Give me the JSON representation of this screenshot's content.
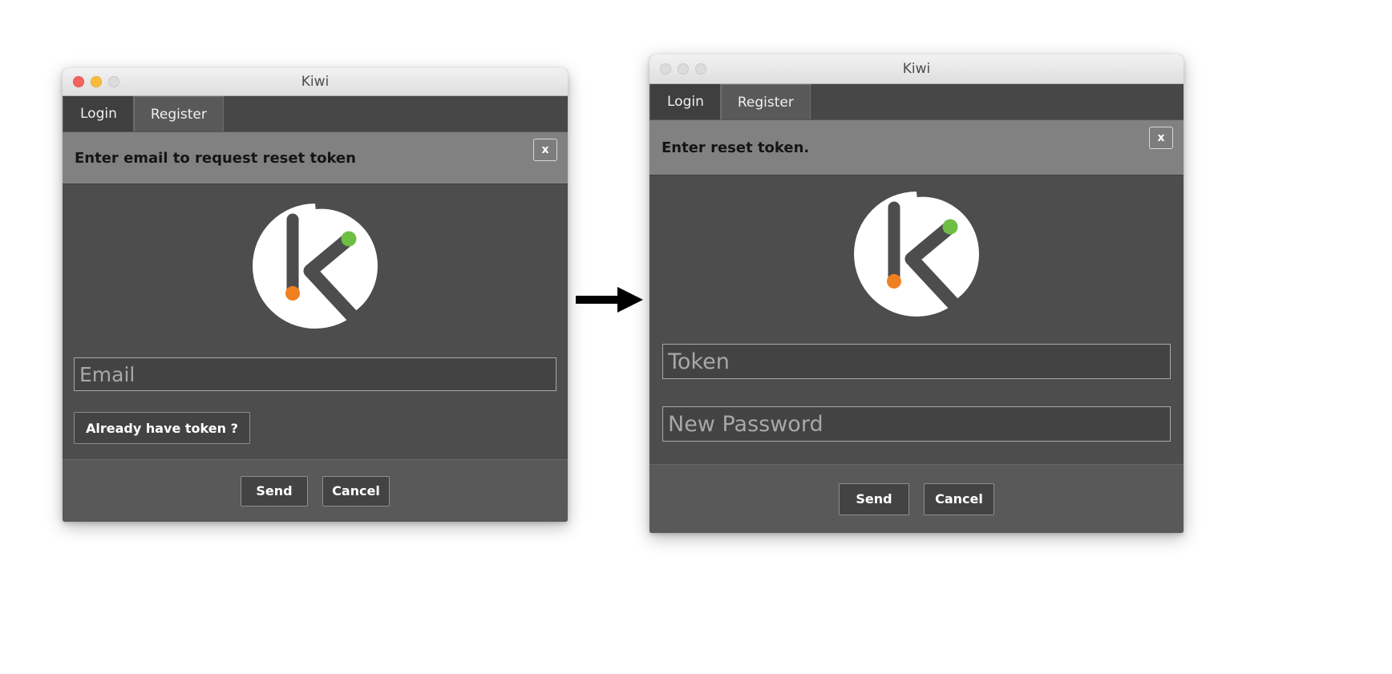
{
  "background_color": "#ffffff",
  "arrow": {
    "name": "flow-arrow",
    "color": "#000000",
    "direction": "right"
  },
  "windows": [
    {
      "id": "left",
      "title": "Kiwi",
      "traffic_lights": [
        "close-red",
        "minimize-yellow",
        "zoom-gray"
      ],
      "traffic_state": "active",
      "tabs": [
        {
          "label": "Login",
          "active": true
        },
        {
          "label": "Register",
          "active": false
        }
      ],
      "banner": {
        "message": "Enter email to request reset token",
        "close_label": "x"
      },
      "logo": {
        "name": "kiwi-logo",
        "circle_color": "#ffffff",
        "letter_color": "#4d4d4d",
        "dot_bottom_color": "#ef8022",
        "dot_top_color": "#6fbe44"
      },
      "fields": [
        {
          "name": "email-input",
          "placeholder": "Email",
          "value": ""
        }
      ],
      "secondary_button": {
        "label": "Already have token ?"
      },
      "footer_buttons": [
        {
          "label": "Send"
        },
        {
          "label": "Cancel"
        }
      ]
    },
    {
      "id": "right",
      "title": "Kiwi",
      "traffic_lights": [
        "close-gray",
        "minimize-gray",
        "zoom-gray"
      ],
      "traffic_state": "inactive",
      "tabs": [
        {
          "label": "Login",
          "active": true
        },
        {
          "label": "Register",
          "active": false
        }
      ],
      "banner": {
        "message": "Enter reset token.",
        "close_label": "x"
      },
      "logo": {
        "name": "kiwi-logo",
        "circle_color": "#ffffff",
        "letter_color": "#4d4d4d",
        "dot_bottom_color": "#ef8022",
        "dot_top_color": "#6fbe44"
      },
      "fields": [
        {
          "name": "token-input",
          "placeholder": "Token",
          "value": ""
        },
        {
          "name": "new-password-input",
          "placeholder": "New Password",
          "value": ""
        }
      ],
      "footer_buttons": [
        {
          "label": "Send"
        },
        {
          "label": "Cancel"
        }
      ]
    }
  ]
}
